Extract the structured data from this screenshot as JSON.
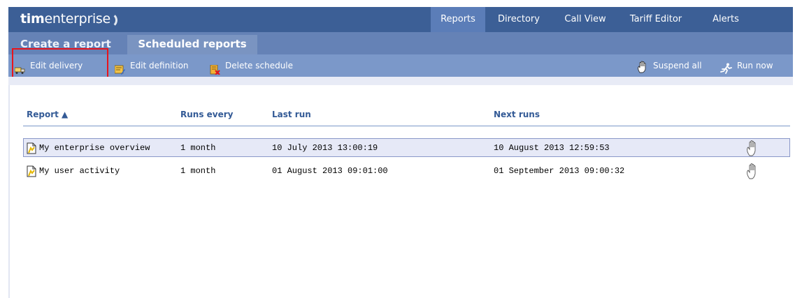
{
  "app": {
    "logo_bold": "tim",
    "logo_rest": "enterprise"
  },
  "nav": {
    "tabs": [
      {
        "label": "Reports",
        "active": true
      },
      {
        "label": "Directory",
        "active": false
      },
      {
        "label": "Call View",
        "active": false
      },
      {
        "label": "Tariff Editor",
        "active": false
      },
      {
        "label": "Alerts",
        "active": false
      }
    ]
  },
  "subtabs": {
    "create": "Create a report",
    "scheduled": "Scheduled reports"
  },
  "toolbar": {
    "edit_delivery": "Edit delivery",
    "edit_definition": "Edit definition",
    "delete_schedule": "Delete schedule",
    "suspend_all": "Suspend all",
    "run_now": "Run now"
  },
  "table": {
    "columns": [
      "Report ▲",
      "Runs every",
      "Last run",
      "Next runs"
    ],
    "rows": [
      {
        "report": "My enterprise overview",
        "runs_every": "1 month",
        "last_run": "10 July 2013 13:00:19",
        "next_runs": "10 August 2013 12:59:53",
        "selected": true
      },
      {
        "report": "My user activity",
        "runs_every": "1 month",
        "last_run": "01 August 2013 09:01:00",
        "next_runs": "01 September 2013 09:00:32",
        "selected": false
      }
    ]
  },
  "colors": {
    "nav_bg": "#3c5f96",
    "active_tab": "#5b7db8",
    "toolbar_bg": "#7b98c9",
    "header_text": "#335a96",
    "highlight_box": "#e8141c",
    "selected_row": "#e6e9f7"
  }
}
